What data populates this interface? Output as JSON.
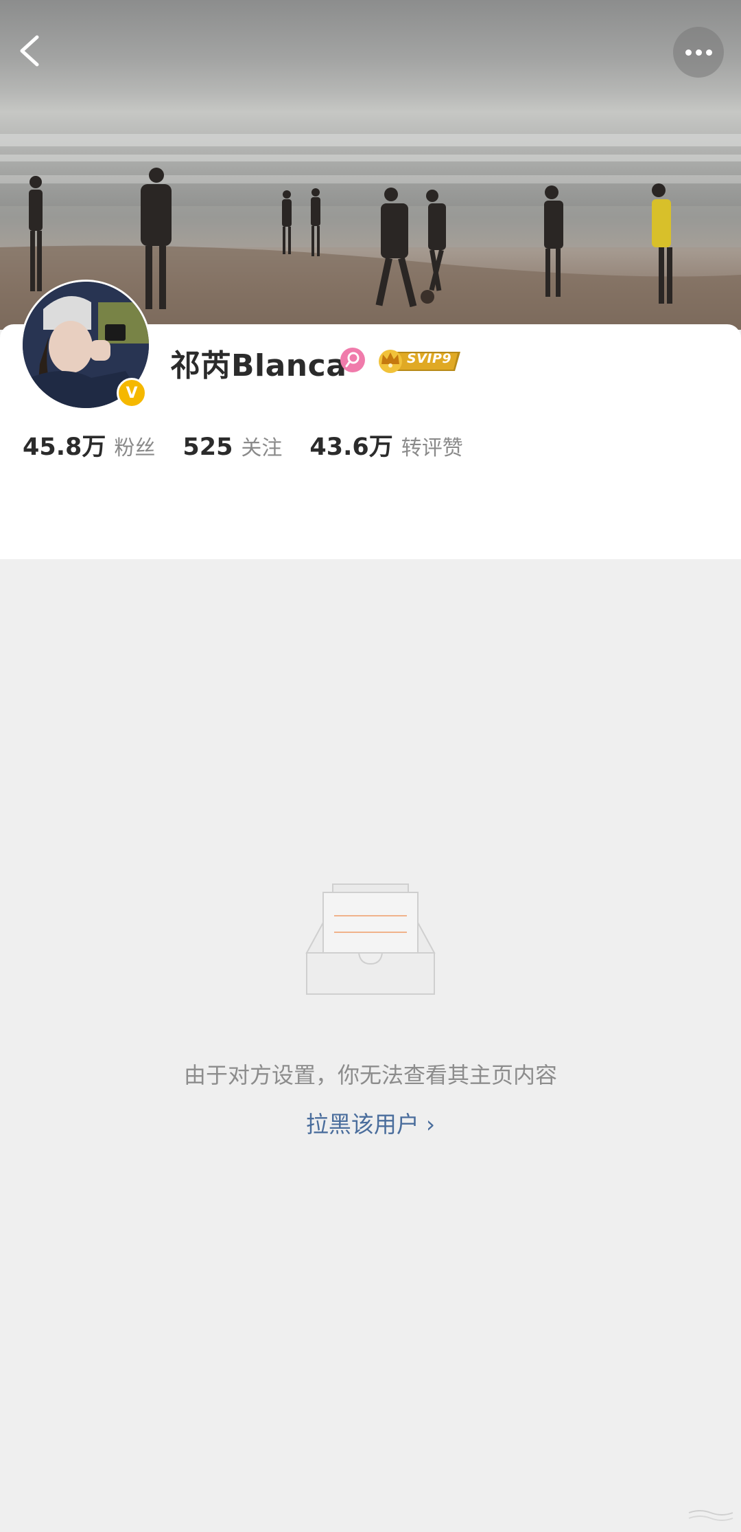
{
  "header": {
    "back_icon": "chevron-left-icon",
    "more_icon": "more-dots-icon"
  },
  "profile": {
    "name": "祁芮Blanca",
    "gender_icon": "female-icon",
    "vip_badge": "SVIP9",
    "verified_badge": "V",
    "stats": [
      {
        "value": "45.8万",
        "label": "粉丝"
      },
      {
        "value": "525",
        "label": "关注"
      },
      {
        "value": "43.6万",
        "label": "转评赞"
      }
    ]
  },
  "empty_state": {
    "icon": "empty-inbox-icon",
    "message": "由于对方设置，你无法查看其主页内容",
    "action_label": "拉黑该用户",
    "action_chevron": "›"
  },
  "colors": {
    "background": "#efefef",
    "card": "#ffffff",
    "link": "#4a6d9c",
    "gender_pink": "#f07bab",
    "verified_gold": "#f5b800"
  }
}
